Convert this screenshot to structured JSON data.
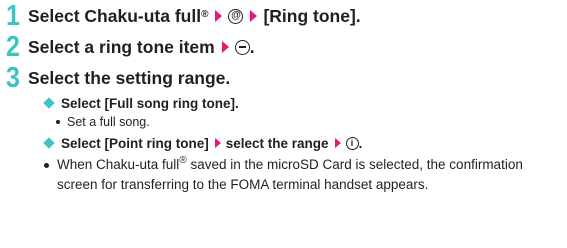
{
  "steps": [
    {
      "number": "1",
      "part1": "Select Chaku-uta full",
      "sup": "®",
      "part3": "[Ring tone].",
      "icons": [
        "arrow-icon",
        "camera-key-icon",
        "arrow-icon"
      ]
    },
    {
      "number": "2",
      "part1": "Select a ring tone item",
      "part3": ".",
      "icons": [
        "arrow-icon",
        "minus-key-icon"
      ]
    },
    {
      "number": "3",
      "part1": "Select the setting range."
    }
  ],
  "options": [
    {
      "label": "Select [Full song ring tone].",
      "sub": "Set a full song."
    },
    {
      "part1": "Select [Point ring tone]",
      "part2": "select the range",
      "part3": ".",
      "icons": [
        "arrow-icon",
        "arrow-icon",
        "info-key-icon"
      ]
    }
  ],
  "note": {
    "part1": "When Chaku-uta full",
    "sup": "®",
    "part2": " saved in the microSD Card is selected, the confirmation screen for transferring to the FOMA terminal handset appears."
  },
  "colors": {
    "step_number": "#3cc3c5",
    "arrow": "#e2197a",
    "diamond": "#3cc3c5",
    "text": "#231f20"
  }
}
